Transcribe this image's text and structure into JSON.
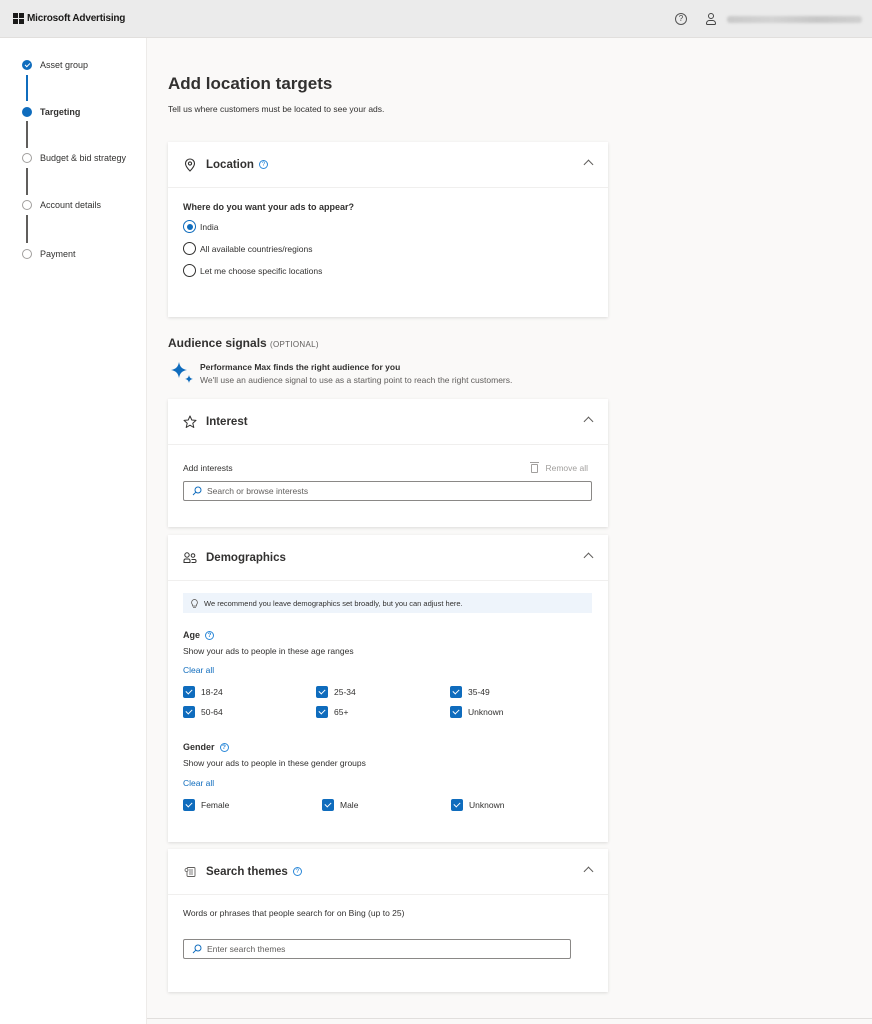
{
  "header": {
    "brand": "Microsoft Advertising",
    "help_label": "?",
    "user_email": "redacted account email"
  },
  "steps": [
    {
      "label": "Asset group",
      "state": "done"
    },
    {
      "label": "Targeting",
      "state": "current"
    },
    {
      "label": "Budget & bid strategy",
      "state": "pending"
    },
    {
      "label": "Account details",
      "state": "pending"
    },
    {
      "label": "Payment",
      "state": "pending"
    }
  ],
  "page": {
    "title": "Add location targets",
    "subtitle": "Tell us where customers must be located to see your ads."
  },
  "location": {
    "title": "Location",
    "help": "?",
    "question": "Where do you want your ads to appear?",
    "options": [
      {
        "label": "India",
        "selected": true
      },
      {
        "label": "All available countries/regions",
        "selected": false
      },
      {
        "label": "Let me choose specific locations",
        "selected": false
      }
    ]
  },
  "audience": {
    "title": "Audience signals",
    "optional": "(OPTIONAL)",
    "pm_title": "Performance Max finds the right audience for you",
    "pm_sub": "We'll use an audience signal to use as a starting point to reach the right customers."
  },
  "interest": {
    "title": "Interest",
    "add_label": "Add interests",
    "remove_all": "Remove all",
    "search_placeholder": "Search or browse interests",
    "search_value": ""
  },
  "demographics": {
    "title": "Demographics",
    "tip": "We recommend you leave demographics set broadly, but you can adjust here.",
    "age": {
      "label": "Age",
      "help": "?",
      "desc": "Show your ads to people in these age ranges",
      "clear": "Clear all",
      "options": [
        {
          "label": "18-24",
          "checked": true
        },
        {
          "label": "25-34",
          "checked": true
        },
        {
          "label": "35-49",
          "checked": true
        },
        {
          "label": "50-64",
          "checked": true
        },
        {
          "label": "65+",
          "checked": true
        },
        {
          "label": "Unknown",
          "checked": true
        }
      ]
    },
    "gender": {
      "label": "Gender",
      "help": "?",
      "desc": "Show your ads to people in these gender groups",
      "clear": "Clear all",
      "options": [
        {
          "label": "Female",
          "checked": true
        },
        {
          "label": "Male",
          "checked": true
        },
        {
          "label": "Unknown",
          "checked": true
        }
      ]
    }
  },
  "search_themes": {
    "title": "Search themes",
    "help": "?",
    "desc": "Words or phrases that people search for on Bing (up to 25)",
    "placeholder": "Enter search themes",
    "value": ""
  },
  "colors": {
    "accent": "#0f6cbd",
    "page_bg": "#faf9f8",
    "topbar_bg": "#ebebeb",
    "tip_bg": "#eef4fb"
  }
}
